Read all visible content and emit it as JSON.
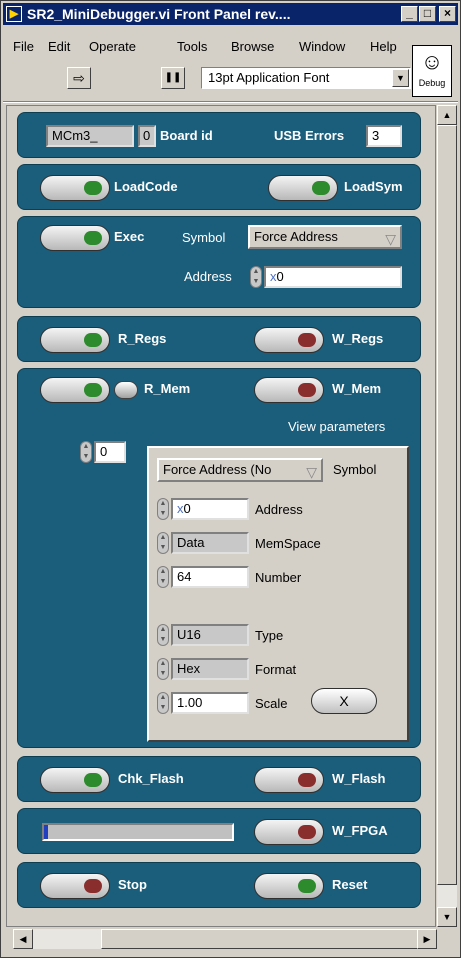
{
  "window": {
    "title": "SR2_MiniDebugger.vi Front Panel rev....",
    "app_icon": "labview-run-icon",
    "minimize": "_",
    "maximize": "□",
    "close": "×"
  },
  "menu": [
    "File",
    "Edit",
    "Operate",
    "Tools",
    "Browse",
    "Window",
    "Help"
  ],
  "toolbar": {
    "run_glyph": "⇨",
    "pause_glyph": "❚❚",
    "font": "13pt Application Font",
    "font_arrow": "▼",
    "debug_icon_label": "Debug"
  },
  "scroll": {
    "up": "▲",
    "down": "▼",
    "left": "◀",
    "right": "▶"
  },
  "board": {
    "name": "MCm3_",
    "id_value": "0",
    "id_label": "Board id",
    "usb_label": "USB Errors",
    "usb_value": "3"
  },
  "load": {
    "code": "LoadCode",
    "sym": "LoadSym"
  },
  "exec": {
    "label": "Exec",
    "symbol_label": "Symbol",
    "symbol_value": "Force Address",
    "address_label": "Address",
    "address_prefix": "x",
    "address_value": "0"
  },
  "regs": {
    "read": "R_Regs",
    "write": "W_Regs"
  },
  "mem": {
    "read": "R_Mem",
    "write": "W_Mem",
    "view_label": "View parameters",
    "index": "0",
    "symbol_value": "Force Address (No",
    "symbol_label": "Symbol",
    "address_prefix": "x",
    "address_value": "0",
    "address_label": "Address",
    "memspace_value": "Data",
    "memspace_label": "MemSpace",
    "number_value": "64",
    "number_label": "Number",
    "type_value": "U16",
    "type_label": "Type",
    "format_value": "Hex",
    "format_label": "Format",
    "scale_value": "1.00",
    "scale_label": "Scale",
    "close_glyph": "X"
  },
  "flash": {
    "check": "Chk_Flash",
    "write": "W_Flash"
  },
  "fpga": {
    "write": "W_FPGA",
    "progress": 0.02
  },
  "control": {
    "stop": "Stop",
    "reset": "Reset"
  },
  "colors": {
    "section_bg": "#1a5e7c",
    "title_bg": "#0a246a",
    "led_green": "#2d8a2d",
    "led_red": "#8a2d2d"
  }
}
